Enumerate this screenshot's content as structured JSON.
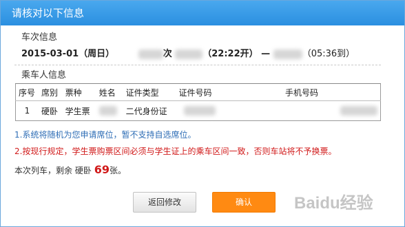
{
  "dialog": {
    "title": "请核对以下信息",
    "train_section_title": "车次信息",
    "train": {
      "date": "2015-03-01",
      "weekday": "（周日）",
      "train_suffix": "次",
      "depart_time": "（22:22开）",
      "arrow": "—",
      "arrive_time": "（05:36到）"
    },
    "passenger_section_title": "乘车人信息",
    "table": {
      "headers": [
        "序号",
        "席别",
        "票种",
        "姓名",
        "证件类型",
        "证件号码",
        "手机号码"
      ],
      "rows": [
        [
          "1",
          "硬卧",
          "学生票",
          "",
          "二代身份证",
          "",
          ""
        ]
      ]
    },
    "note1": "1.系统将随机为您申请席位，暂不支持自选席位。",
    "note2": "2.按现行规定，学生票购票区间必须与学生证上的乘车区间一致，否则车站将不予换票。",
    "remain": {
      "prefix": "本次列车，剩余",
      "seat": "硬卧",
      "count": "69",
      "unit": "张。"
    },
    "buttons": {
      "back": "返回修改",
      "confirm": "确认"
    }
  },
  "watermark": "Baidu经验"
}
